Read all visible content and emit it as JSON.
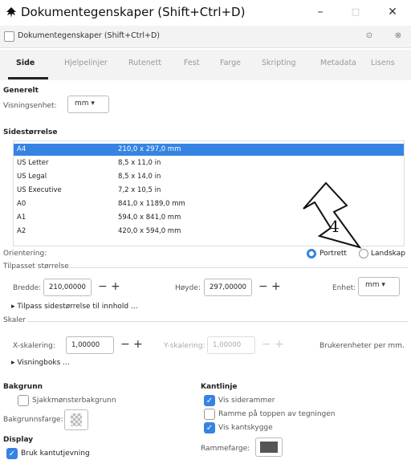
{
  "window": {
    "title": "Dokumentegenskaper  (Shift+Ctrl+D)",
    "minimize": "–",
    "maximize": "□",
    "close": "✕"
  },
  "subbar": {
    "title": "Dokumentegenskaper (Shift+Ctrl+D)",
    "btn1": "⊙",
    "btn2": "⊗"
  },
  "tabs": [
    "Side",
    "Hjelpelinjer",
    "Rutenett",
    "Fest",
    "Farge",
    "Skripting",
    "Metadata",
    "Lisens"
  ],
  "general": {
    "heading": "Generelt",
    "unit_label": "Visningsenhet:",
    "unit_value": "mm ▾"
  },
  "size": {
    "heading": "Sidestørrelse",
    "rows": [
      {
        "name": "A4",
        "dims": "210,0 x 297,0 mm"
      },
      {
        "name": "US Letter",
        "dims": "8,5 x 11,0 in"
      },
      {
        "name": "US Legal",
        "dims": "8,5 x 14,0 in"
      },
      {
        "name": "US Executive",
        "dims": "7,2 x 10,5 in"
      },
      {
        "name": "A0",
        "dims": "841,0 x 1189,0 mm"
      },
      {
        "name": "A1",
        "dims": "594,0 x 841,0 mm"
      },
      {
        "name": "A2",
        "dims": "420,0 x 594,0 mm"
      }
    ]
  },
  "orientation": {
    "label": "Orientering:",
    "portrait": "Portrett",
    "landscape": "Landskap"
  },
  "custom": {
    "heading": "Tilpasset størrelse",
    "width_label": "Bredde:",
    "width_value": "210,00000",
    "height_label": "Høyde:",
    "height_value": "297,00000",
    "unit_label": "Enhet:",
    "unit_value": "mm ▾",
    "fit_link": "▸  Tilpass sidestørrelse til innhold ..."
  },
  "scale": {
    "heading": "Skaler",
    "x_label": "X-skalering:",
    "x_value": "1,00000",
    "y_label": "Y-skalering:",
    "y_value": "1,00000",
    "units_text": "Brukerenheter per mm.",
    "viewbox": "▸  Visningboks ..."
  },
  "background": {
    "heading": "Bakgrunn",
    "checker": "Sjakkmønsterbakgrunn",
    "color_label": "Bakgrunnsfarge:"
  },
  "display": {
    "heading": "Display",
    "antialias": "Bruk kantutjevning"
  },
  "border": {
    "heading": "Kantlinje",
    "show_border": "Vis siderammer",
    "border_on_top": "Ramme på toppen av tegningen",
    "show_shadow": "Vis kantskygge",
    "color_label": "Rammefarge:"
  },
  "annotation": {
    "number": "4"
  },
  "colors": {
    "accent": "#3584e4",
    "border_swatch": "#555555"
  }
}
